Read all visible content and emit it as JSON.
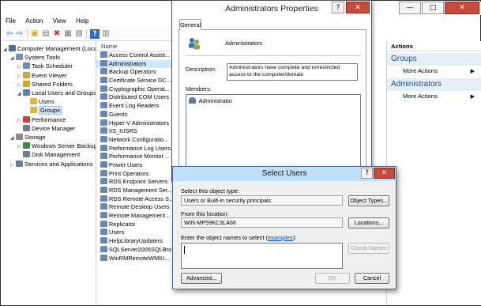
{
  "mmc": {
    "menu": [
      "File",
      "Action",
      "View",
      "Help"
    ],
    "title_controls": {
      "minimize": "—",
      "maximize": "□",
      "close": "✕"
    }
  },
  "tree": {
    "items": [
      {
        "label": "Computer Management (Local",
        "level": 0,
        "expander": "▲"
      },
      {
        "label": "System Tools",
        "level": 1,
        "expander": "▲"
      },
      {
        "label": "Task Scheduler",
        "level": 2,
        "expander": "▷"
      },
      {
        "label": "Event Viewer",
        "level": 2,
        "expander": "▷"
      },
      {
        "label": "Shared Folders",
        "level": 2,
        "expander": "▷"
      },
      {
        "label": "Local Users and Groups",
        "level": 2,
        "expander": "▲"
      },
      {
        "label": "Users",
        "level": 3,
        "expander": ""
      },
      {
        "label": "Groups",
        "level": 3,
        "expander": "",
        "selected": true
      },
      {
        "label": "Performance",
        "level": 2,
        "expander": "▷"
      },
      {
        "label": "Device Manager",
        "level": 2,
        "expander": ""
      },
      {
        "label": "Storage",
        "level": 1,
        "expander": "▲"
      },
      {
        "label": "Windows Server Backup",
        "level": 2,
        "expander": "▷"
      },
      {
        "label": "Disk Management",
        "level": 2,
        "expander": ""
      },
      {
        "label": "Services and Applications",
        "level": 1,
        "expander": "▷"
      }
    ]
  },
  "list": {
    "header": "Name",
    "rows": [
      "Access Control Assist...",
      "Administrators",
      "Backup Operators",
      "Certificate Service DC...",
      "Cryptographic Operat...",
      "Distributed COM Users",
      "Event Log Readers",
      "Guests",
      "Hyper-V Administrators",
      "IIS_IUSRS",
      "Network Configuratio...",
      "Performance Log Users",
      "Performance Monitor ...",
      "Power Users",
      "Print Operators",
      "RDS Endpoint Servers",
      "RDS Management Ser...",
      "RDS Remote Access S...",
      "Remote Desktop Users",
      "Remote Management...",
      "Replicator",
      "Users",
      "HelpLibraryUpdaters",
      "SQLServer2005SQLBro...",
      "WinRMRemoteWMIU..."
    ],
    "selected_index": 1
  },
  "actions": {
    "header": "Actions",
    "sections": [
      {
        "title": "Groups",
        "item": "More Actions"
      },
      {
        "title": "Administrators",
        "item": "More Actions"
      }
    ]
  },
  "properties": {
    "title": "Administrators Properties",
    "tab": "General",
    "group_name": "Administrators",
    "description_label": "Description:",
    "description": "Administrators have complete and unrestricted access to the computer/domain",
    "members_label": "Members:",
    "members": [
      "Administrator"
    ],
    "help_glyph": "?",
    "close_glyph": "✕"
  },
  "select_users": {
    "title": "Select Users",
    "object_type_label": "Select this object type:",
    "object_type_value": "Users or Built-in security principals",
    "object_types_button": "Object Types...",
    "location_label": "From this location:",
    "location_value": "WIN-MP59KC3LA66",
    "locations_button": "Locations...",
    "names_label_prefix": "Enter the object names to select (",
    "names_label_link": "examples",
    "names_label_suffix": "):",
    "names_value": "",
    "check_names_button": "Check Names",
    "advanced_button": "Advanced...",
    "ok_button": "OK",
    "cancel_button": "Cancel",
    "help_glyph": "?",
    "close_glyph": "✕"
  }
}
